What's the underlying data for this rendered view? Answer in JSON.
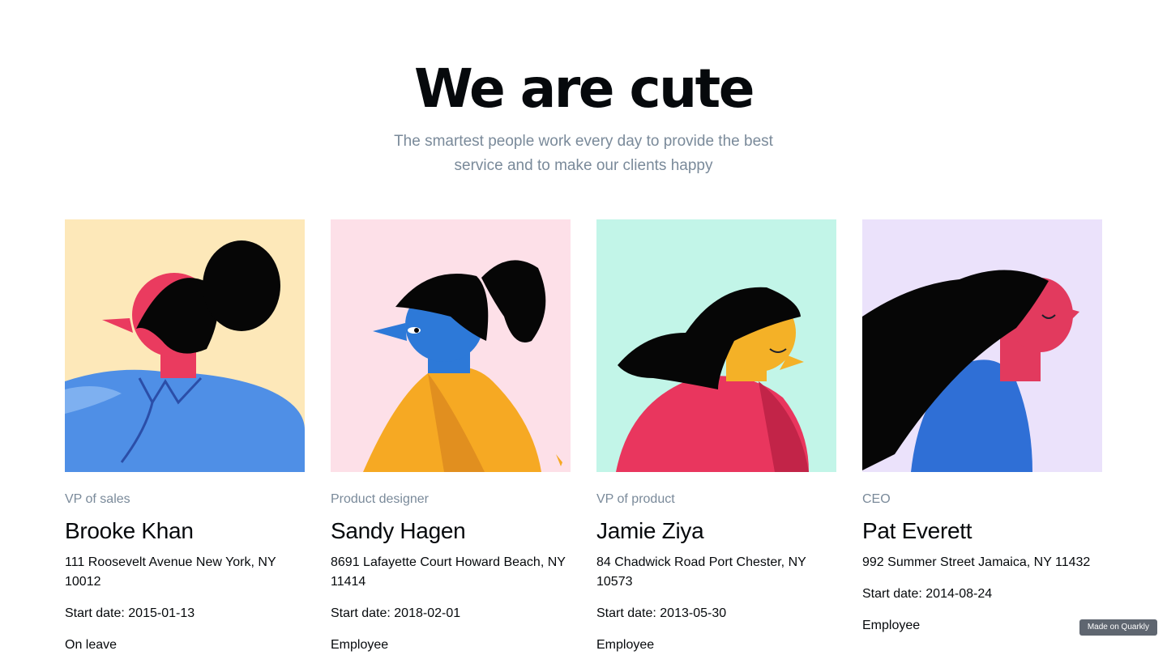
{
  "hero": {
    "title": "We are cute",
    "subtitle": "The smartest people work every day to provide the best service and to make our clients happy"
  },
  "members": [
    {
      "role": "VP of sales",
      "name": "Brooke Khan",
      "address": "111 Roosevelt Avenue New York, NY 10012",
      "start_date": "Start date: 2015-01-13",
      "status": "On leave",
      "portrait_bg": "#fde8b9"
    },
    {
      "role": "Product designer",
      "name": "Sandy Hagen",
      "address": "8691 Lafayette Court Howard Beach, NY 11414",
      "start_date": "Start date: 2018-02-01",
      "status": "Employee",
      "portrait_bg": "#fde0e8"
    },
    {
      "role": "VP of product",
      "name": "Jamie Ziya",
      "address": "84 Chadwick Road Port Chester, NY 10573",
      "start_date": "Start date: 2013-05-30",
      "status": "Employee",
      "portrait_bg": "#c2f5e8"
    },
    {
      "role": "CEO",
      "name": "Pat Everett",
      "address": "992 Summer Street Jamaica, NY 11432",
      "start_date": "Start date: 2014-08-24",
      "status": "Employee",
      "portrait_bg": "#ebe2fb"
    }
  ],
  "badge": {
    "label": "Made on Quarkly"
  },
  "colors": {
    "heading": "#06090c",
    "muted": "#7a8a9a",
    "badge_bg": "#5f6670"
  }
}
